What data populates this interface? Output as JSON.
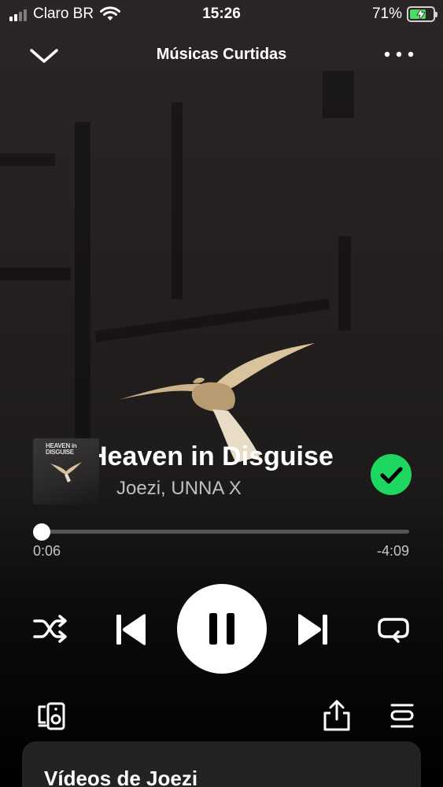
{
  "status_bar": {
    "carrier": "Claro BR",
    "time": "15:26",
    "battery_percent": "71%",
    "battery_level": 0.71,
    "charging": true,
    "icons": [
      "cellular-signal-icon",
      "wifi-icon",
      "battery-charging-icon"
    ]
  },
  "header": {
    "title": "Músicas Curtidas",
    "icons": [
      "chevron-down-icon",
      "more-options-icon"
    ]
  },
  "cover": {
    "line1": "HEAVEN in",
    "line2": "DISGUISE"
  },
  "track": {
    "title": "Heaven in Disguise",
    "artists": "Joezi, UNNA X",
    "liked": true
  },
  "playback": {
    "elapsed": "0:06",
    "remaining": "-4:09",
    "progress_fraction": 0.024,
    "state": "playing"
  },
  "controls": {
    "icons": [
      "shuffle-icon",
      "previous-icon",
      "pause-icon",
      "next-icon",
      "repeat-icon"
    ]
  },
  "bottom_actions": {
    "icons": [
      "connect-device-icon",
      "share-icon",
      "queue-icon"
    ]
  },
  "section": {
    "title": "Vídeos de Joezi"
  },
  "colors": {
    "accent_green": "#1ed760",
    "battery_green": "#4cd964",
    "background": "#000000"
  }
}
